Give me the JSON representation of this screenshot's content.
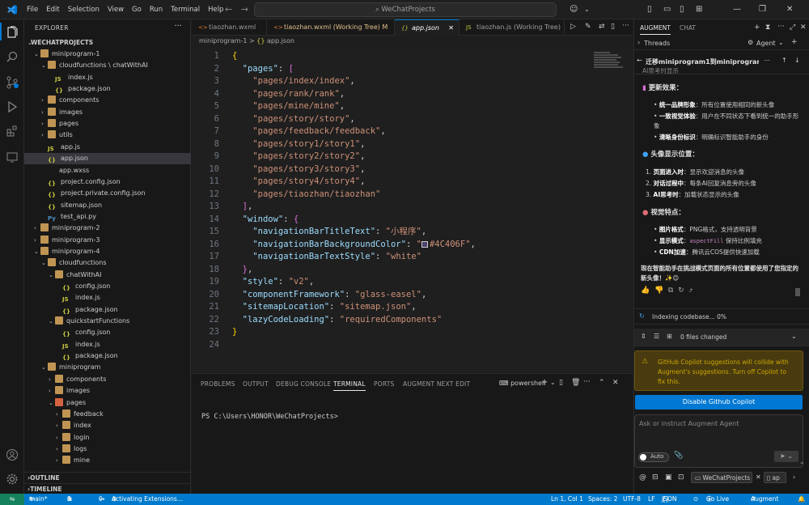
{
  "titlebar": {
    "menus": [
      "File",
      "Edit",
      "Selection",
      "View",
      "Go",
      "Run",
      "Terminal",
      "Help"
    ],
    "search": "WeChatProjects"
  },
  "sidebar": {
    "title": "EXPLORER",
    "root": "WECHATPROJECTS",
    "outline": "OUTLINE",
    "timeline": "TIMELINE",
    "items": [
      {
        "label": "miniprogram-1",
        "depth": 0,
        "kind": "folder",
        "open": true
      },
      {
        "label": "cloudfunctions \\ chatWithAI",
        "depth": 1,
        "kind": "folder",
        "open": true
      },
      {
        "label": "index.js",
        "depth": 2,
        "kind": "js"
      },
      {
        "label": "package.json",
        "depth": 2,
        "kind": "json"
      },
      {
        "label": "components",
        "depth": 1,
        "kind": "folder"
      },
      {
        "label": "images",
        "depth": 1,
        "kind": "folder"
      },
      {
        "label": "pages",
        "depth": 1,
        "kind": "folder"
      },
      {
        "label": "utils",
        "depth": 1,
        "kind": "folder"
      },
      {
        "label": "app.js",
        "depth": 1,
        "kind": "js"
      },
      {
        "label": "app.json",
        "depth": 1,
        "kind": "json",
        "selected": true
      },
      {
        "label": "app.wxss",
        "depth": 1,
        "kind": "css"
      },
      {
        "label": "project.config.json",
        "depth": 1,
        "kind": "json"
      },
      {
        "label": "project.private.config.json",
        "depth": 1,
        "kind": "json"
      },
      {
        "label": "sitemap.json",
        "depth": 1,
        "kind": "json"
      },
      {
        "label": "test_api.py",
        "depth": 1,
        "kind": "py"
      },
      {
        "label": "miniprogram-2",
        "depth": 0,
        "kind": "folder"
      },
      {
        "label": "miniprogram-3",
        "depth": 0,
        "kind": "folder"
      },
      {
        "label": "miniprogram-4",
        "depth": 0,
        "kind": "folder",
        "open": true
      },
      {
        "label": "cloudfunctions",
        "depth": 1,
        "kind": "folder",
        "open": true
      },
      {
        "label": "chatWithAI",
        "depth": 2,
        "kind": "folder",
        "open": true
      },
      {
        "label": "config.json",
        "depth": 3,
        "kind": "json"
      },
      {
        "label": "index.js",
        "depth": 3,
        "kind": "js"
      },
      {
        "label": "package.json",
        "depth": 3,
        "kind": "json"
      },
      {
        "label": "quickstartFunctions",
        "depth": 2,
        "kind": "folder",
        "open": true
      },
      {
        "label": "config.json",
        "depth": 3,
        "kind": "json"
      },
      {
        "label": "index.js",
        "depth": 3,
        "kind": "js"
      },
      {
        "label": "package.json",
        "depth": 3,
        "kind": "json"
      },
      {
        "label": "miniprogram",
        "depth": 1,
        "kind": "folder",
        "open": true
      },
      {
        "label": "components",
        "depth": 2,
        "kind": "folder"
      },
      {
        "label": "images",
        "depth": 2,
        "kind": "folder"
      },
      {
        "label": "pages",
        "depth": 2,
        "kind": "folder-red",
        "open": true
      },
      {
        "label": "feedback",
        "depth": 3,
        "kind": "folder"
      },
      {
        "label": "index",
        "depth": 3,
        "kind": "folder"
      },
      {
        "label": "login",
        "depth": 3,
        "kind": "folder"
      },
      {
        "label": "logs",
        "depth": 3,
        "kind": "folder"
      },
      {
        "label": "mine",
        "depth": 3,
        "kind": "folder"
      }
    ]
  },
  "tabs": [
    {
      "label": "tiaozhan.wxml",
      "kind": "xml"
    },
    {
      "label": "tiaozhan.wxml (Working Tree)",
      "badge": "M",
      "kind": "xml"
    },
    {
      "label": "app.json",
      "kind": "json",
      "active": true
    },
    {
      "label": "tiaozhan.js (Working Tree)",
      "kind": "js"
    }
  ],
  "breadcrumb": {
    "folder": "miniprogram-1",
    "sep": ">",
    "file": "app.json"
  },
  "code_lines": [
    "{",
    "  \"pages\": [",
    "    \"pages/index/index\",",
    "    \"pages/rank/rank\",",
    "    \"pages/mine/mine\",",
    "    \"pages/story/story\",",
    "    \"pages/feedback/feedback\",",
    "    \"pages/story1/story1\",",
    "    \"pages/story2/story2\",",
    "    \"pages/story3/story3\",",
    "    \"pages/story4/story4\",",
    "    \"pages/tiaozhan/tiaozhan\"",
    "  ],",
    "  \"window\": {",
    "    \"navigationBarTitleText\": \"小程序\",",
    "    \"navigationBarBackgroundColor\": \"#4C406F\",",
    "    \"navigationBarTextStyle\": \"white\"",
    "  },",
    "  \"style\": \"v2\",",
    "  \"componentFramework\": \"glass-easel\",",
    "  \"sitemapLocation\": \"sitemap.json\",",
    "  \"lazyCodeLoading\": \"requiredComponents\"",
    "}",
    ""
  ],
  "color_swatch": "#4C406F",
  "panel": {
    "tabs": [
      "PROBLEMS",
      "OUTPUT",
      "DEBUG CONSOLE",
      "TERMINAL",
      "PORTS",
      "AUGMENT NEXT EDIT"
    ],
    "active_tab": "TERMINAL",
    "shell": "powershell",
    "prompt": "PS C:\\Users\\HONOR\\WeChatProjects>"
  },
  "right": {
    "tabs": [
      "AUGMENT",
      "CHAT"
    ],
    "threads": "Threads",
    "agent": "Agent",
    "thread_title": "迁移miniprogram1到miniprogram4...",
    "truncated_line": "AI思考时显示",
    "section1": "更新效果：",
    "bullets1": [
      {
        "bold": "统一品牌形象",
        "text": "：所有位置使用相同的新头像"
      },
      {
        "bold": "一致视觉体验",
        "text": "：用户在不同状态下看到统一的助手形象"
      },
      {
        "bold": "清晰身份标识",
        "text": "：明确标识智能助手的身份"
      }
    ],
    "section2": "头像显示位置：",
    "numbered": [
      {
        "bold": "页面进入时",
        "text": "：显示欢迎消息的头像"
      },
      {
        "bold": "对话过程中",
        "text": "：每条AI回复消息旁的头像"
      },
      {
        "bold": "AI思考时",
        "text": "：加载状态显示的头像"
      }
    ],
    "section3": "视觉特点：",
    "bullets3": [
      {
        "bold": "图片格式",
        "text": "：PNG格式，支持透明背景"
      },
      {
        "bold": "显示模式",
        "text": "：",
        "code": "aspectFill",
        "after": " 保持比例填充"
      },
      {
        "bold": "CDN加速",
        "text": "：腾讯云COS提供快速加载"
      }
    ],
    "summary": "现在智能助手在挑战模式页面的所有位置都使用了您指定的新头像！✨😊",
    "indexing": "Indexing codebase... 0%",
    "files_changed": "0 files changed",
    "warning": "GitHub Copilot suggestions will collide with Augment's suggestions. Turn off Copilot to fix this.",
    "disable_button": "Disable Github Copilot",
    "input_placeholder": "Ask or instruct Augment Agent",
    "auto": "Auto",
    "context_chip": "WeChatProjects",
    "context_chip2": "ap"
  },
  "status": {
    "branch": "main*",
    "errors": "0",
    "warnings": "0",
    "ports": "0",
    "activity": "Activating Extensions...",
    "position": "Ln 1, Col 1",
    "spaces": "Spaces: 2",
    "encoding": "UTF-8",
    "eol": "LF",
    "language": "JSON",
    "golive": "Go Live",
    "augment": "Augment"
  }
}
